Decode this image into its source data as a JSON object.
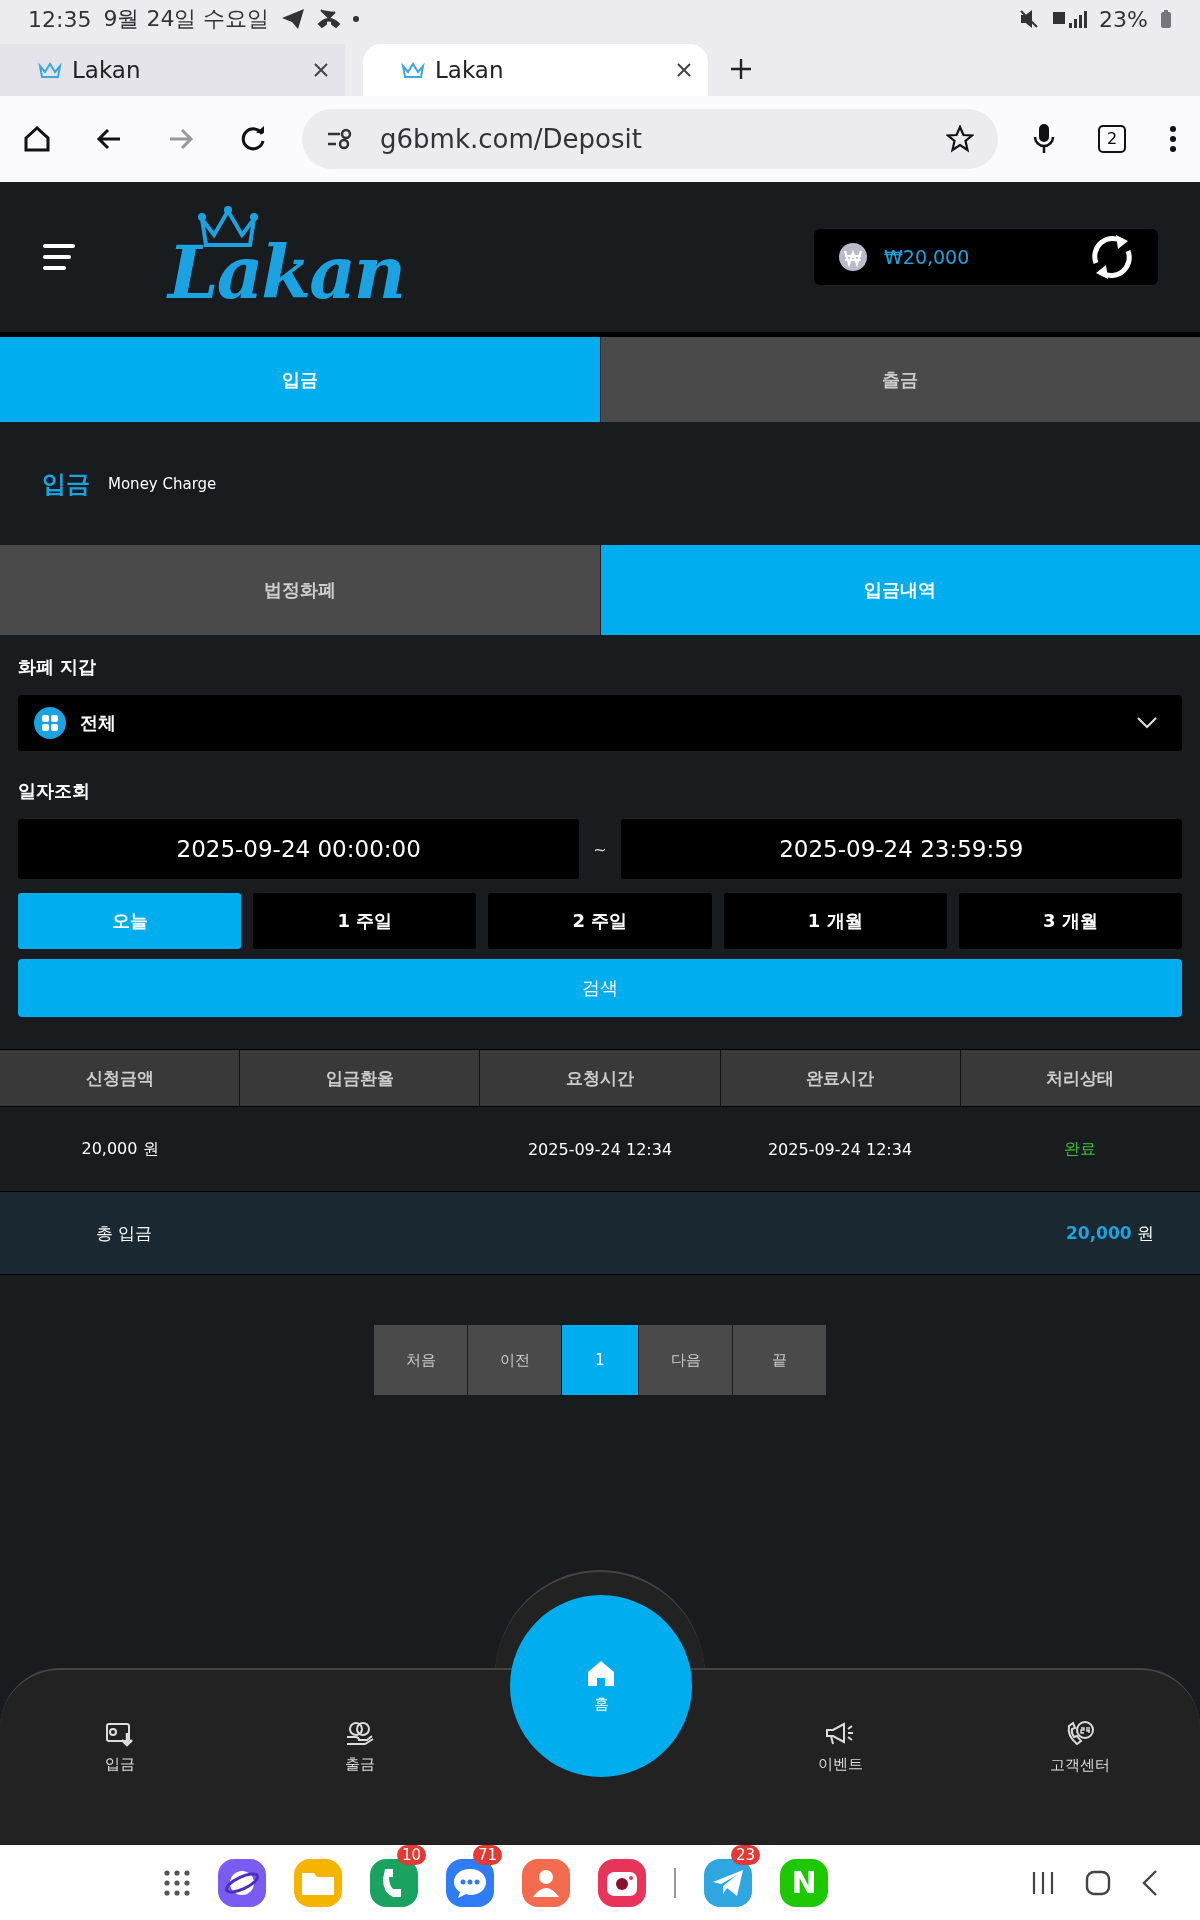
{
  "status_bar": {
    "time": "12:35",
    "date": "9월 24일 수요일",
    "battery": "23%"
  },
  "browser": {
    "tabs": [
      {
        "title": "Lakan",
        "selected": false
      },
      {
        "title": "Lakan",
        "selected": true
      }
    ],
    "url": "g6bmk.com/Deposit",
    "tab_count": "2"
  },
  "header": {
    "logo": "Lakan",
    "balance": "₩20,000"
  },
  "main_tabs": [
    {
      "label": "입금",
      "selected": true
    },
    {
      "label": "출금",
      "selected": false
    }
  ],
  "section": {
    "title": "입금",
    "subtitle": "Money Charge"
  },
  "sub_tabs": [
    {
      "label": "법정화폐",
      "selected": false
    },
    {
      "label": "입금내역",
      "selected": true
    }
  ],
  "wallet": {
    "label": "화폐 지갑",
    "value": "전체"
  },
  "date_filter": {
    "label": "일자조회",
    "from": "2025-09-24 00:00:00",
    "separator": "~",
    "to": "2025-09-24 23:59:59"
  },
  "periods": [
    {
      "label": "오늘",
      "selected": true
    },
    {
      "label": "1 주일",
      "selected": false
    },
    {
      "label": "2 주일",
      "selected": false
    },
    {
      "label": "1 개월",
      "selected": false
    },
    {
      "label": "3 개월",
      "selected": false
    }
  ],
  "search_button": "검색",
  "table": {
    "columns": [
      "신청금액",
      "입금환율",
      "요청시간",
      "완료시간",
      "처리상태"
    ],
    "rows": [
      {
        "amount": "20,000 원",
        "requested": "2025-09-24 12:34",
        "completed": "2025-09-24 12:34",
        "status": "완료"
      }
    ]
  },
  "total": {
    "label": "총 입금",
    "amount": "20,000",
    "unit": "원"
  },
  "pagination": [
    {
      "label": "처음",
      "selected": false
    },
    {
      "label": "이전",
      "selected": false
    },
    {
      "label": "1",
      "selected": true
    },
    {
      "label": "다음",
      "selected": false
    },
    {
      "label": "끝",
      "selected": false
    }
  ],
  "bottom_nav": [
    {
      "label": "입금",
      "kind": "deposit"
    },
    {
      "label": "출금",
      "kind": "withdraw"
    },
    {
      "label": "홈",
      "kind": "home"
    },
    {
      "label": "이벤트",
      "kind": "event"
    },
    {
      "label": "고객센터",
      "kind": "support"
    }
  ],
  "dock": [
    {
      "kind": "grid"
    },
    {
      "kind": "internet"
    },
    {
      "kind": "files"
    },
    {
      "kind": "phone",
      "badge": "10"
    },
    {
      "kind": "messages",
      "badge": "71"
    },
    {
      "kind": "contacts"
    },
    {
      "kind": "camera"
    },
    {
      "kind": "divider"
    },
    {
      "kind": "telegram",
      "badge": "23"
    },
    {
      "kind": "naver",
      "label": "N"
    }
  ]
}
